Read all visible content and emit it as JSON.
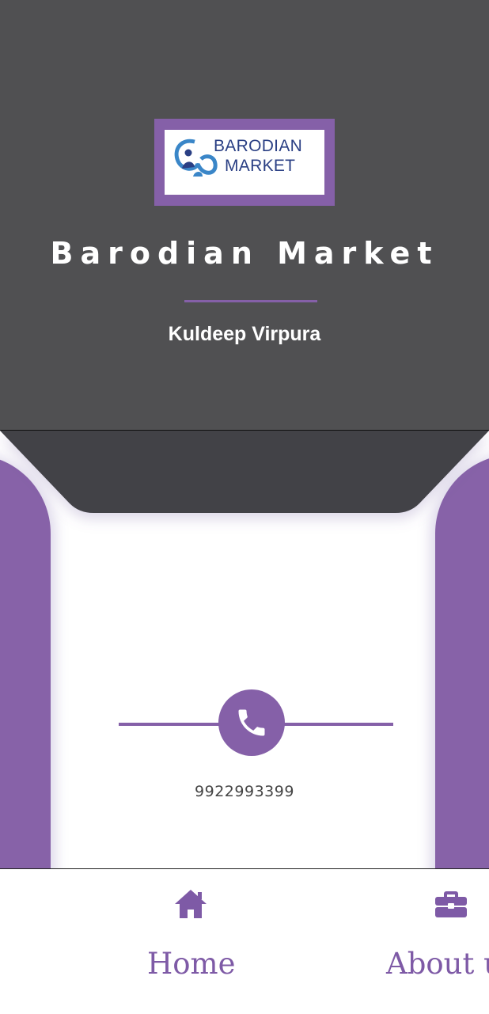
{
  "header": {
    "logo": {
      "line1": "BARODIAN",
      "line2": "MARKET"
    },
    "title": "Barodian Market",
    "owner": "Kuldeep Virpura"
  },
  "contact": {
    "icon": "phone-icon",
    "phone": "9922993399"
  },
  "nav": {
    "items": [
      {
        "label": "Home",
        "icon": "home-icon"
      },
      {
        "label": "About u",
        "icon": "briefcase-icon"
      }
    ]
  },
  "colors": {
    "accent": "#8560a8",
    "header_bg": "#505052",
    "notch": "#434347"
  }
}
